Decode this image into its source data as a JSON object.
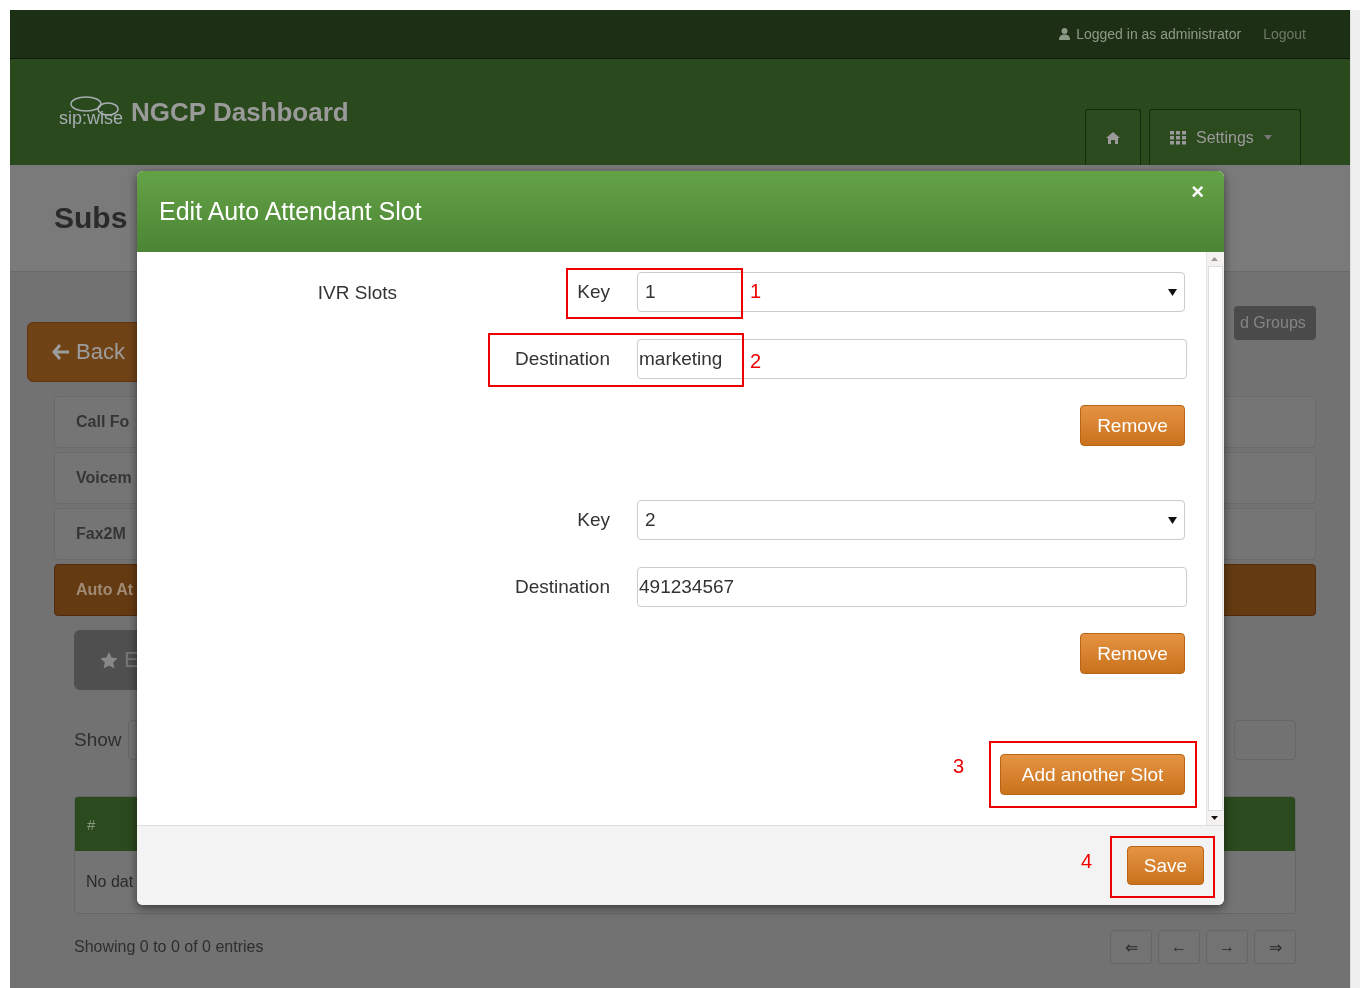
{
  "top_bar": {
    "user": "Logged in as administrator",
    "logout": "Logout"
  },
  "header": {
    "logo_text": "sip:wise",
    "title": "NGCP Dashboard",
    "settings": "Settings"
  },
  "page": {
    "title": "Subs",
    "back": "Back",
    "groups_button": "d Groups",
    "accordion": [
      {
        "label": "Call Fo",
        "selected": false
      },
      {
        "label": "Voicem",
        "selected": false
      },
      {
        "label": "Fax2M",
        "selected": false
      },
      {
        "label": "Auto At",
        "selected": true
      }
    ],
    "action_button": "E",
    "show_label": "Show",
    "table": {
      "columns": [
        "#"
      ],
      "rows": [
        [
          "No dat"
        ]
      ]
    },
    "info": "Showing 0 to 0 of 0 entries",
    "pagination": [
      "⇐",
      "←",
      "→",
      "⇒"
    ]
  },
  "modal": {
    "title": "Edit Auto Attendant Slot",
    "close": "×",
    "section_label": "IVR Slots",
    "slots": [
      {
        "key_label": "Key",
        "key": "1",
        "destination_label": "Destination",
        "destination": "marketing",
        "remove": "Remove"
      },
      {
        "key_label": "Key",
        "key": "2",
        "destination_label": "Destination",
        "destination": "491234567",
        "remove": "Remove"
      }
    ],
    "add_button": "Add another Slot",
    "save_button": "Save"
  },
  "annotations": [
    {
      "number": "1"
    },
    {
      "number": "2"
    },
    {
      "number": "3"
    },
    {
      "number": "4"
    }
  ]
}
